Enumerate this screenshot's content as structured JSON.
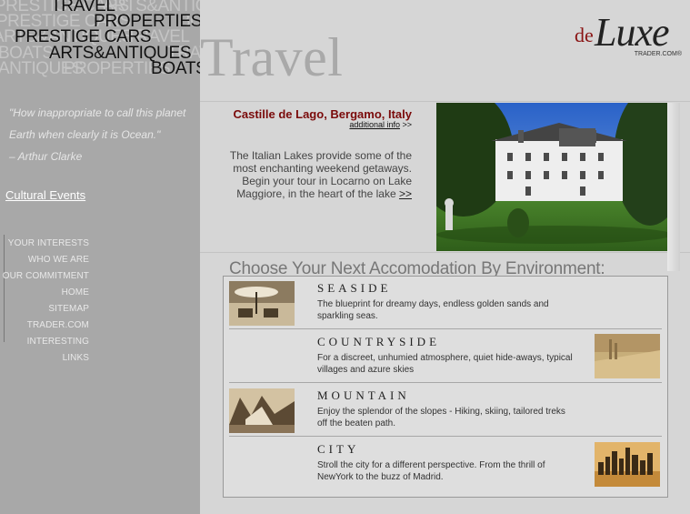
{
  "header": {
    "section_title": "Travel",
    "logo": {
      "de": "de",
      "luxe": "Luxe",
      "trader": "TRADER.COM®"
    }
  },
  "categories": {
    "travel": "TRAVEL",
    "properties": "PROPERTIES",
    "prestige_cars": "PRESTIGE CARS",
    "arts_antiques": "ARTS&ANTIQUES",
    "boats": "BOATS",
    "background": {
      "w1": "PRESTIGE CARS",
      "w2": "ARTS&ANTIQ",
      "w3": "PRESTIGE CARS",
      "w4": "BO",
      "w5": "ARTS&ANTIQUES",
      "w6": "TRAVEL",
      "w7": "BOATS",
      "w8": "TRAVELAR",
      "w9": "ANTIQUES",
      "w10": "PROPERTIES"
    }
  },
  "sidebar": {
    "quote": "\"How inappropriate to call this planet Earth when clearly it is Ocean.\"",
    "author": "– Arthur Clarke",
    "cultural_events": "Cultural Events",
    "nav": [
      "YOUR INTERESTS",
      "WHO WE ARE",
      "OUR COMMITMENT",
      "HOME",
      "SITEMAP",
      "TRADER.COM",
      "INTERESTING LINKS"
    ]
  },
  "featured": {
    "title": "Castille de Lago, Bergamo, Italy",
    "additional_info": "additional info",
    "arrows": ">>",
    "description": "The Italian Lakes provide some of the most enchanting weekend getaways. Begin your tour in Locarno on Lake Maggiore, in the heart of the lake",
    "more": ">>"
  },
  "environment": {
    "heading": "Choose Your Next Accomodation By Environment:",
    "items": [
      {
        "name": "SEASIDE",
        "desc": "The blueprint for dreamy days, endless golden sands and sparkling seas."
      },
      {
        "name": "COUNTRYSIDE",
        "desc": "For a discreet, unhumied atmosphere, quiet hide-aways, typical villages and azure skies"
      },
      {
        "name": "MOUNTAIN",
        "desc": "Enjoy the splendor of the slopes - Hiking, skiing, tailored treks off the beaten path."
      },
      {
        "name": "CITY",
        "desc": "Stroll the city for a different perspective. From the thrill of NewYork to the buzz of Madrid."
      }
    ]
  },
  "colors": {
    "sidebar": "#a8a8a8",
    "main": "#d6d6d6",
    "accent_red": "#7a0a0a"
  }
}
